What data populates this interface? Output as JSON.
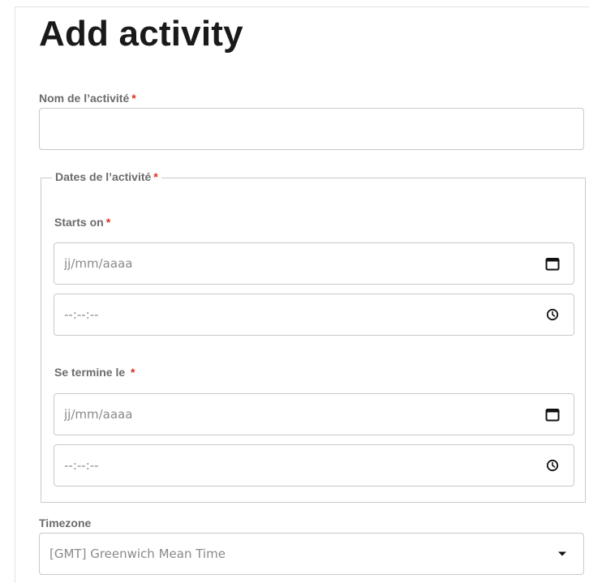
{
  "page": {
    "title": "Add activity"
  },
  "form": {
    "name_field": {
      "label": "Nom de l’activité",
      "required_mark": "*",
      "value": ""
    },
    "dates_group": {
      "legend": "Dates de l’activité",
      "required_mark": "*",
      "starts": {
        "label": "Starts on",
        "required_mark": "*",
        "date_placeholder": "jj/mm/aaaa",
        "time_placeholder": "--:--:--"
      },
      "ends": {
        "label": "Se termine le ",
        "required_mark": "*",
        "date_placeholder": "jj/mm/aaaa",
        "time_placeholder": "--:--:--"
      }
    },
    "timezone": {
      "label": "Timezone",
      "selected": "[GMT] Greenwich Mean Time"
    }
  },
  "icons": {
    "date": "calendar-icon",
    "time": "clock-icon",
    "select": "caret-down-icon"
  }
}
